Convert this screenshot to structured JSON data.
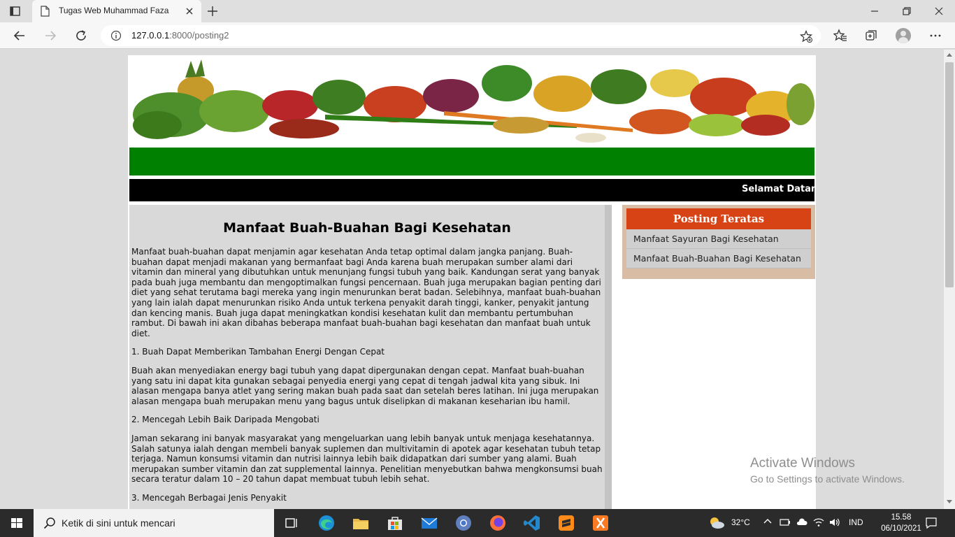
{
  "browser": {
    "tab_title": "Tugas Web Muhammad Faza",
    "url_host": "127.0.0.1",
    "url_rest": ":8000/posting2"
  },
  "page": {
    "marquee_text": "Selamat Datang d",
    "article": {
      "title": "Manfaat Buah-Buahan Bagi Kesehatan",
      "paragraphs": [
        "Manfaat buah-buahan dapat menjamin agar kesehatan Anda tetap optimal dalam jangka panjang. Buah-buahan dapat menjadi makanan yang bermanfaat bagi Anda karena buah merupakan sumber alami dari vitamin dan mineral yang dibutuhkan untuk menunjang fungsi tubuh yang baik. Kandungan serat yang banyak pada buah juga membantu dan mengoptimalkan fungsi pencernaan. Buah juga merupakan bagian penting dari diet yang sehat terutama bagi mereka yang ingin menurunkan berat badan. Selebihnya, manfaat buah-buahan yang lain ialah dapat menurunkan risiko Anda untuk terkena penyakit darah tinggi, kanker, penyakit jantung dan kencing manis. Buah juga dapat meningkatkan kondisi kesehatan kulit dan membantu pertumbuhan rambut. Di bawah ini akan dibahas beberapa manfaat buah-buahan bagi kesehatan dan manfaat buah untuk diet.",
        "1. Buah Dapat Memberikan Tambahan Energi Dengan Cepat",
        "Buah akan menyediakan energy bagi tubuh yang dapat dipergunakan dengan cepat. Manfaat buah-buahan yang satu ini dapat kita gunakan sebagai penyedia energi yang cepat di tengah jadwal kita yang sibuk. Ini alasan mengapa banya atlet yang sering makan buah pada saat dan setelah beres latihan. Ini juga merupakan alasan mengapa buah merupakan menu yang bagus untuk diselipkan di makanan keseharian ibu hamil.",
        "2. Mencegah Lebih Baik Daripada Mengobati",
        "Jaman sekarang ini banyak masyarakat yang mengeluarkan uang lebih banyak untuk menjaga kesehatannya. Salah satunya ialah dengan membeli banyak suplemen dan multivitamin di apotek agar kesehatan tubuh tetap terjaga. Namun konsumsi vitamin dan nutrisi lainnya lebih baik didapatkan dari sumber yang alami. Buah merupakan sumber vitamin dan zat supplemental lainnya. Penelitian menyebutkan bahwa mengkonsumsi buah secara teratur dalam 10 – 20 tahun dapat membuat tubuh lebih sehat.",
        "3. Mencegah Berbagai Jenis Penyakit"
      ]
    },
    "sidebar": {
      "heading": "Posting Teratas",
      "items": [
        "Manfaat Sayuran Bagi Kesehatan",
        "Manfaat Buah-Buahan Bagi Kesehatan"
      ]
    }
  },
  "watermark": {
    "line1": "Activate Windows",
    "line2": "Go to Settings to activate Windows."
  },
  "taskbar": {
    "search_placeholder": "Ketik di sini untuk mencari",
    "temperature": "32°C",
    "language": "IND",
    "time": "15.58",
    "date": "06/10/2021"
  },
  "colors": {
    "header_green": "#008000",
    "sidebar_heading": "#d84315",
    "sidebar_frame": "#d8bca4"
  }
}
